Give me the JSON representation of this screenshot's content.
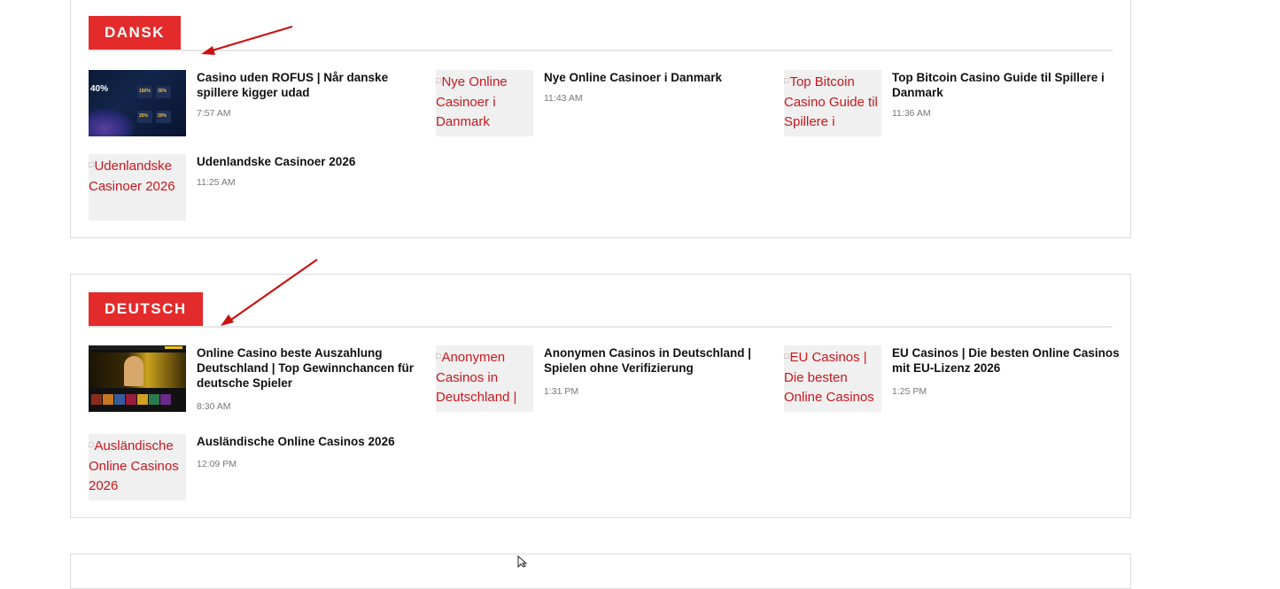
{
  "sections": [
    {
      "label": "DANSK",
      "posts": [
        {
          "title": "Casino uden ROFUS | Når danske spillere kigger udad",
          "time": "7:57 AM",
          "thumb_text": "40%"
        },
        {
          "title": "Nye Online Casinoer i Danmark",
          "time": "11:43 AM",
          "alt": "Nye Online Casinoer i Danmark"
        },
        {
          "title": "Top Bitcoin Casino Guide til Spillere i Danmark",
          "time": "11:36 AM",
          "alt": "Top Bitcoin Casino Guide til Spillere i Danmark"
        },
        {
          "title": "Udenlandske Casinoer 2026",
          "time": "11:25 AM",
          "alt": "Udenlandske Casinoer 2026"
        }
      ]
    },
    {
      "label": "DEUTSCH",
      "posts": [
        {
          "title": "Online Casino beste Auszahlung Deutschland | Top Gewinnchancen für deutsche Spieler",
          "time": "8:30 AM"
        },
        {
          "title": "Anonymen Casinos in Deutschland | Spielen ohne Verifizierung",
          "time": "1:31 PM",
          "alt": "Anonymen Casinos in Deutschland | Spielen ohne Verifizierung"
        },
        {
          "title": "EU Casinos | Die besten Online Casinos mit EU-Lizenz 2026",
          "time": "1:25 PM",
          "alt": "EU Casinos | Die besten Online Casinos mit EU-Lizenz 2026"
        },
        {
          "title": "Ausländische Online Casinos 2026",
          "time": "12:09 PM",
          "alt": "Ausländische Online Casinos 2026"
        }
      ]
    }
  ],
  "colors": {
    "accent": "#e32b2b",
    "alt_text": "#c8181e",
    "annotation_arrow": "#cc1111"
  }
}
